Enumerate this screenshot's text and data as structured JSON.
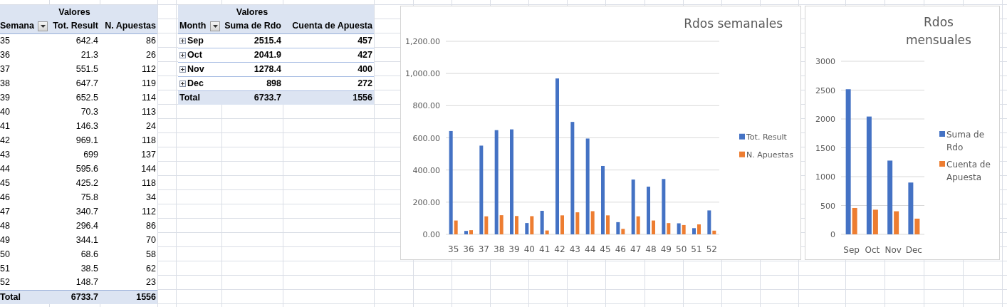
{
  "pivot_weekly": {
    "header": "Valores",
    "columns": [
      "Semana",
      "Tot. Result",
      "N. Apuestas"
    ],
    "rows": [
      [
        "35",
        "642.4",
        "86"
      ],
      [
        "36",
        "21.3",
        "26"
      ],
      [
        "37",
        "551.5",
        "112"
      ],
      [
        "38",
        "647.7",
        "119"
      ],
      [
        "39",
        "652.5",
        "114"
      ],
      [
        "40",
        "70.3",
        "113"
      ],
      [
        "41",
        "146.3",
        "24"
      ],
      [
        "42",
        "969.1",
        "118"
      ],
      [
        "43",
        "699",
        "137"
      ],
      [
        "44",
        "595.6",
        "144"
      ],
      [
        "45",
        "425.2",
        "118"
      ],
      [
        "46",
        "75.8",
        "34"
      ],
      [
        "47",
        "340.7",
        "112"
      ],
      [
        "48",
        "296.4",
        "86"
      ],
      [
        "49",
        "344.1",
        "70"
      ],
      [
        "50",
        "68.6",
        "58"
      ],
      [
        "51",
        "38.5",
        "62"
      ],
      [
        "52",
        "148.7",
        "23"
      ]
    ],
    "total": [
      "Total",
      "6733.7",
      "1556"
    ]
  },
  "pivot_monthly": {
    "header": "Valores",
    "columns": [
      "Month",
      "Suma de Rdo",
      "Cuenta de Apuesta"
    ],
    "rows": [
      {
        "cells": [
          "Sep",
          "2515.4",
          "457"
        ],
        "expanded": false
      },
      {
        "cells": [
          "Oct",
          "2041.9",
          "427"
        ],
        "expanded": false
      },
      {
        "cells": [
          "Nov",
          "1278.4",
          "400"
        ],
        "expanded": false
      },
      {
        "cells": [
          "Dec",
          "898",
          "272"
        ],
        "expanded": false
      }
    ],
    "total": [
      "Total",
      "6733.7",
      "1556"
    ]
  },
  "chart_weekly": {
    "chart_data": {
      "type": "bar",
      "title": "Rdos semanales",
      "categories": [
        "35",
        "36",
        "37",
        "38",
        "39",
        "40",
        "41",
        "42",
        "43",
        "44",
        "45",
        "46",
        "47",
        "48",
        "49",
        "50",
        "51",
        "52"
      ],
      "series": [
        {
          "name": "Tot. Result",
          "color": "#4472c4",
          "values": [
            642.4,
            21.3,
            551.5,
            647.7,
            652.5,
            70.3,
            146.3,
            969.1,
            699,
            595.6,
            425.2,
            75.8,
            340.7,
            296.4,
            344.1,
            68.6,
            38.5,
            148.7
          ]
        },
        {
          "name": "N. Apuestas",
          "color": "#ed7d31",
          "values": [
            86,
            26,
            112,
            119,
            114,
            113,
            24,
            118,
            137,
            144,
            118,
            34,
            112,
            86,
            70,
            58,
            62,
            23
          ]
        }
      ],
      "grid": true,
      "legend": true,
      "ylim": [
        0,
        1200
      ],
      "yticks": [
        {
          "value": 0,
          "label": "0.00"
        },
        {
          "value": 200,
          "label": "200.00"
        },
        {
          "value": 400,
          "label": "400.00"
        },
        {
          "value": 600,
          "label": "600.00"
        },
        {
          "value": 800,
          "label": "800.00"
        },
        {
          "value": 1000,
          "label": "1,000.00"
        },
        {
          "value": 1200,
          "label": "1,200.00"
        }
      ]
    }
  },
  "chart_monthly": {
    "chart_data": {
      "type": "bar",
      "title": "Rdos mensuales",
      "categories": [
        "Sep",
        "Oct",
        "Nov",
        "Dec"
      ],
      "series": [
        {
          "name": "Suma de Rdo",
          "color": "#4472c4",
          "values": [
            2515.4,
            2041.9,
            1278.4,
            898
          ]
        },
        {
          "name": "Cuenta de Apuesta",
          "color": "#ed7d31",
          "values": [
            457,
            427,
            400,
            272
          ]
        }
      ],
      "grid": true,
      "legend": true,
      "ylim": [
        0,
        3000
      ],
      "yticks": [
        0,
        500,
        1000,
        1500,
        2000,
        2500,
        3000
      ]
    }
  }
}
